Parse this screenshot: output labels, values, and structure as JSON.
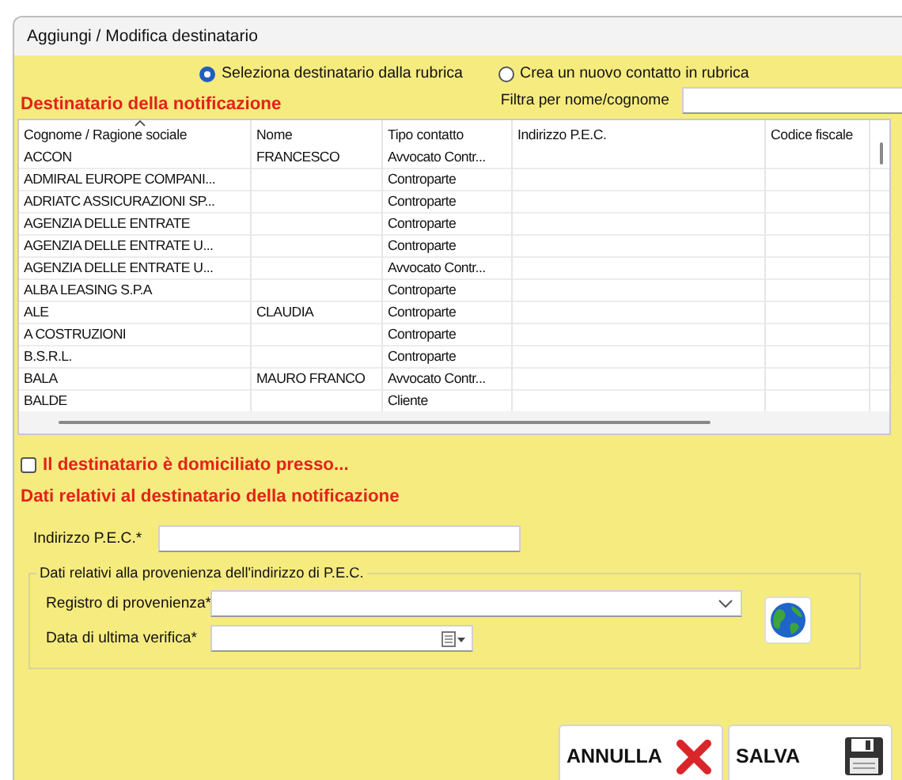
{
  "window": {
    "title": "Aggiungi / Modifica destinatario"
  },
  "source_options": [
    {
      "label": "Seleziona destinatario dalla rubrica",
      "selected": true
    },
    {
      "label": "Crea un nuovo contatto in rubrica",
      "selected": false
    }
  ],
  "recipient_heading": "Destinatario della notificazione",
  "filter": {
    "label": "Filtra per nome/cognome"
  },
  "table": {
    "columns": [
      {
        "label": "Cognome / Ragione sociale",
        "sorted": true
      },
      {
        "label": "Nome",
        "sorted": false
      },
      {
        "label": "Tipo contatto",
        "sorted": false
      },
      {
        "label": "Indirizzo P.E.C.",
        "sorted": false
      },
      {
        "label": "Codice fiscale",
        "sorted": false
      }
    ],
    "rows": [
      {
        "surname": "ACCON",
        "name": "FRANCESCO",
        "type": "Avvocato Contr..."
      },
      {
        "surname": "ADMIRAL EUROPE COMPANI...",
        "type": "Controparte"
      },
      {
        "surname": "ADRIATC ASSICURAZIONI SP...",
        "type": "Controparte"
      },
      {
        "surname": "AGENZIA DELLE ENTRATE",
        "type": "Controparte"
      },
      {
        "surname": "AGENZIA DELLE ENTRATE U...",
        "type": "Controparte"
      },
      {
        "surname": "AGENZIA DELLE ENTRATE U...",
        "type": "Avvocato Contr..."
      },
      {
        "surname": "ALBA LEASING S.P.A",
        "type": "Controparte"
      },
      {
        "surname": "ALE",
        "name": "CLAUDIA",
        "type": "Controparte"
      },
      {
        "surname": "A    COSTRUZIONI",
        "type": "Controparte"
      },
      {
        "surname": "B.S.R.L.",
        "type": "Controparte"
      },
      {
        "surname": "BALA",
        "name": "MAURO FRANCO",
        "type": "Avvocato Contr..."
      },
      {
        "surname": "BALDE",
        "type": "Cliente"
      }
    ]
  },
  "domicile": {
    "label": "Il destinatario è domiciliato presso...",
    "checked": false
  },
  "details_heading": "Dati relativi al destinatario della notificazione",
  "pec_field": {
    "label": "Indirizzo P.E.C.*"
  },
  "provenance": {
    "legend": "Dati relativi alla provenienza dell'indirizzo di P.E.C.",
    "registry": {
      "label": "Registro di provenienza*"
    },
    "verify_date": {
      "label": "Data di ultima verifica*"
    }
  },
  "buttons": [
    {
      "label": "ANNULLA",
      "kind": "cancel"
    },
    {
      "label": "SALVA",
      "kind": "save"
    }
  ]
}
